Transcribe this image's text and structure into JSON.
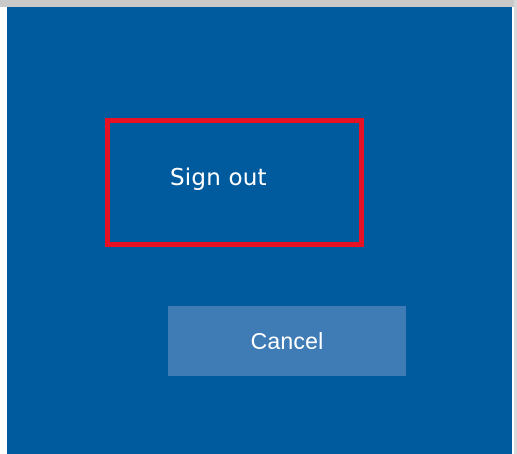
{
  "dialog": {
    "sign_out_label": "Sign out",
    "cancel_label": "Cancel"
  },
  "colors": {
    "panel_background": "#005a9e",
    "highlight_border": "#e81123",
    "cancel_button_background": "#3f7bb5",
    "text": "#ffffff"
  }
}
